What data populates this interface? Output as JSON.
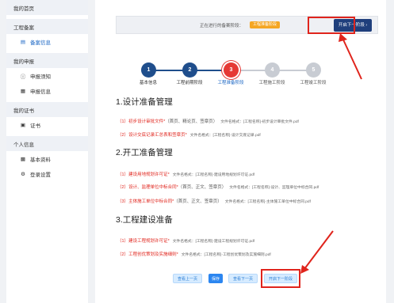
{
  "colors": {
    "primary": "#1a66c4",
    "navy": "#1f3f7c",
    "step_done": "#1f4e8c",
    "step_current": "#e53935",
    "step_pending": "#c8ccd3",
    "highlight": "#e0241c",
    "badge": "#f5a623"
  },
  "sidebar": {
    "items": [
      {
        "label": "我的首页",
        "type": "group"
      },
      {
        "label": "工程备案",
        "type": "group"
      },
      {
        "label": "备案信息",
        "type": "sub",
        "icon": "document-icon",
        "glyph": "▤",
        "active": true
      },
      {
        "label": "我的申报",
        "type": "group"
      },
      {
        "label": "申报须知",
        "type": "sub",
        "icon": "info-icon",
        "glyph": "ⓘ"
      },
      {
        "label": "申报信息",
        "type": "sub",
        "icon": "list-icon",
        "glyph": "▦"
      },
      {
        "label": "我的证书",
        "type": "group"
      },
      {
        "label": "证书",
        "type": "sub",
        "icon": "certificate-icon",
        "glyph": "▣"
      },
      {
        "label": "个人信息",
        "type": "group"
      },
      {
        "label": "基本资料",
        "type": "sub",
        "icon": "profile-icon",
        "glyph": "▩"
      },
      {
        "label": "登录设置",
        "type": "sub",
        "icon": "gear-icon",
        "glyph": "⚙"
      }
    ]
  },
  "stage": {
    "label": "正在进行的备案阶段：",
    "badge": "工程准备阶段",
    "next_button": "开启下一阶段 ›"
  },
  "steps": [
    {
      "num": "1",
      "label": "基本信息",
      "state": "done"
    },
    {
      "num": "2",
      "label": "工程前期阶段",
      "state": "done"
    },
    {
      "num": "3",
      "label": "工程准备阶段",
      "state": "current"
    },
    {
      "num": "4",
      "label": "工程施工阶段",
      "state": "pending"
    },
    {
      "num": "5",
      "label": "工程竣工阶段",
      "state": "pending"
    }
  ],
  "sections": [
    {
      "title": "1.设计准备管理",
      "items": [
        {
          "num": "（1）",
          "name": "初步设计审批文件*",
          "extra": "（首页、精论页、签章页）",
          "fmt": "文件名格式：[工程名称]-初步设计审批文件.pdf"
        },
        {
          "num": "（2）",
          "name": "设计交底记录汇总表和签章页*",
          "extra": "",
          "fmt": "文件名格式：[工程名称]-设计交底记录.pdf"
        }
      ]
    },
    {
      "title": "2.开工准备管理",
      "items": [
        {
          "num": "（1）",
          "name": "建设用地规划许可证*",
          "extra": "",
          "fmt": "文件名格式：[工程名称]-建设用地规划许可证.pdf"
        },
        {
          "num": "（2）",
          "name": "设计、监理单位中标合同*",
          "extra": "（首页、正文、签章页）",
          "fmt": "文件名格式：[工程名称]-设计、监理单位中标合同.pdf"
        },
        {
          "num": "（3）",
          "name": "主体施工单位中标合同*",
          "extra": "（首页、正文、签章页）",
          "fmt": "文件名格式：[工程名称]-主体施工单位中标合同.pdf"
        }
      ]
    },
    {
      "title": "3.工程建设准备",
      "items": [
        {
          "num": "（1）",
          "name": "建设工程规划许可证*",
          "extra": "",
          "fmt": "文件名格式：[工程名称]-建设工程规划许可证.pdf"
        },
        {
          "num": "（2）",
          "name": "工程创优策划及实施细则*",
          "extra": "",
          "fmt": "文件名格式：[工程名称]-工程创优策划及实施细则.pdf"
        }
      ]
    }
  ],
  "actions": {
    "prev": "查看上一页",
    "save": "保存",
    "view_next": "查看下一页",
    "open_next": "开启下一阶段"
  }
}
